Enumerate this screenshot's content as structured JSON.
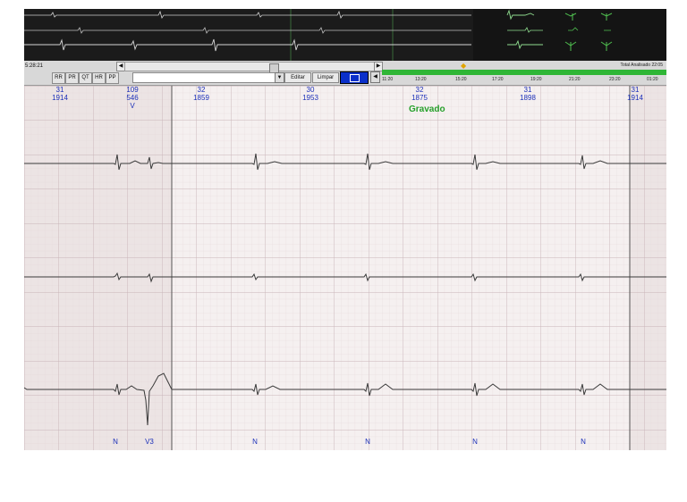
{
  "toolbar": {
    "time": "5:28:21",
    "measure_buttons": [
      "RR",
      "PR",
      "QT",
      "HR",
      "PP"
    ],
    "scroll_left": "◀",
    "scroll_right": "▶",
    "dropdown_arrow": "▼",
    "edit_label": "Editar",
    "clear_label": "Limpar",
    "small_arrow": "◀"
  },
  "timeline": {
    "total_label": "Total Analisado 22:05",
    "ticks": [
      "11:20",
      "13:20",
      "15:20",
      "17:20",
      "19:20",
      "21:20",
      "23:20",
      "01:20"
    ],
    "marker_icon": "warning-icon"
  },
  "ecg": {
    "status": "Gravado",
    "intervals": [
      {
        "hr": "31",
        "rr": "1914",
        "type": ""
      },
      {
        "hr": "109",
        "rr": "546",
        "type": "V"
      },
      {
        "hr": "32",
        "rr": "1859",
        "type": ""
      },
      {
        "hr": "30",
        "rr": "1953",
        "type": ""
      },
      {
        "hr": "32",
        "rr": "1875",
        "type": ""
      },
      {
        "hr": "31",
        "rr": "1898",
        "type": ""
      },
      {
        "hr": "31",
        "rr": "1914",
        "type": ""
      }
    ],
    "beat_labels": [
      "N",
      "V3",
      "N",
      "N",
      "N",
      "N"
    ]
  },
  "colors": {
    "overview_bg": "#1b1b1b",
    "accent_green": "#2fb636",
    "label_blue": "#1b2fb8",
    "status_green": "#26a02b",
    "selected_button": "#0a2fc9"
  }
}
